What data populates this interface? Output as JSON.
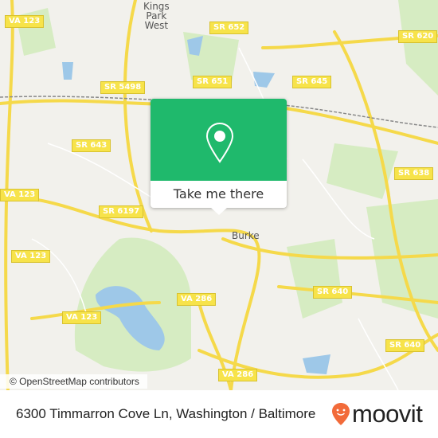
{
  "map": {
    "places": [
      {
        "id": "kings-park-west",
        "label": "Kings\nPark\nWest"
      },
      {
        "id": "burke",
        "label": "Burke"
      }
    ],
    "shields": [
      "VA 123",
      "SR 652",
      "SR 620",
      "SR 5498",
      "SR 651",
      "SR 645",
      "SR 643",
      "SR 638",
      "VA 123",
      "SR 6197",
      "VA 123",
      "SR 640",
      "VA 286",
      "VA 123",
      "SR 640",
      "VA 286"
    ],
    "colors": {
      "road": "#f7e34a",
      "park": "#d6ecc2",
      "water": "#9ec8e8",
      "background": "#f2f1ec"
    },
    "attribution": "© OpenStreetMap contributors"
  },
  "popup": {
    "icon": "map-pin-icon",
    "button_label": "Take me there",
    "color": "#1fb96c"
  },
  "footer": {
    "address": "6300 Timmarron Cove Ln, Washington / Baltimore",
    "brand": "moovit",
    "brand_color": "#f26b3a"
  }
}
